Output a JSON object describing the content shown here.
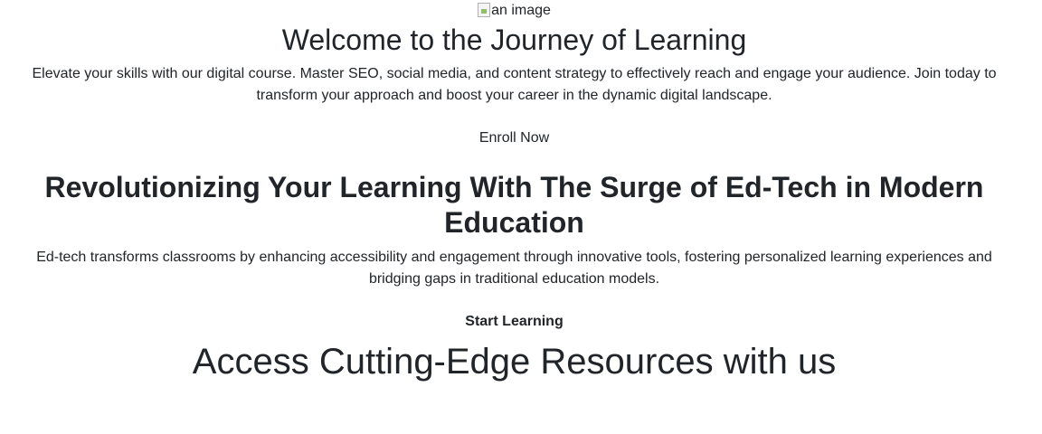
{
  "hero": {
    "image_alt": "an image",
    "title": "Welcome to the Journey of Learning",
    "description": "Elevate your skills with our digital course. Master SEO, social media, and content strategy to effectively reach and engage your audience. Join today to transform your approach and boost your career in the dynamic digital landscape.",
    "cta_label": "Enroll Now"
  },
  "edtech": {
    "title": "Revolutionizing Your Learning With The Surge of Ed-Tech in Modern Education",
    "description": "Ed-tech transforms classrooms by enhancing accessibility and engagement through innovative tools, fostering personalized learning experiences and bridging gaps in traditional education models.",
    "cta_label": "Start Learning"
  },
  "resources": {
    "title": "Access Cutting-Edge Resources with us"
  }
}
